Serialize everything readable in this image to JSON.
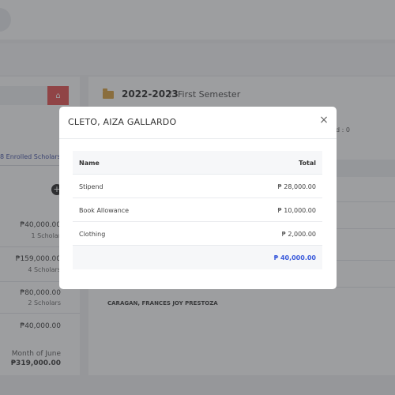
{
  "left_panel": {
    "home_icon": "home-icon",
    "enrolled_label": "8 Enrolled Scholars",
    "plus_icon": "plus-icon",
    "items": [
      {
        "amount": "₱40,000.00",
        "sub": "1 Scholar"
      },
      {
        "amount": "₱159,000.00",
        "sub": "4 Scholars"
      },
      {
        "amount": "₱80,000.00",
        "sub": "2 Scholars"
      },
      {
        "amount": "₱40,000.00",
        "sub": ""
      }
    ],
    "footer_label": "Month of June",
    "footer_amount": "₱319,000.00"
  },
  "main": {
    "folder_icon": "folder-icon",
    "year": "2022-2023",
    "separator": "/",
    "semester": "First Semester",
    "paid_text": "d : 0",
    "row_name": "CARAGAN, FRANCES JOY PRESTOZA"
  },
  "modal": {
    "title": "CLETO, AIZA GALLARDO",
    "close_icon": "close-icon",
    "close_glyph": "×",
    "table": {
      "headers": [
        "Name",
        "Total"
      ],
      "rows": [
        {
          "name": "Stipend",
          "total": "₱ 28,000.00"
        },
        {
          "name": "Book Allowance",
          "total": "₱ 10,000.00"
        },
        {
          "name": "Clothing",
          "total": "₱ 2,000.00"
        }
      ],
      "grand_total": "₱ 40,000.00"
    }
  },
  "colors": {
    "accent": "#3b5bdb",
    "home_button": "#e44a4a",
    "folder": "#d99e3a"
  }
}
